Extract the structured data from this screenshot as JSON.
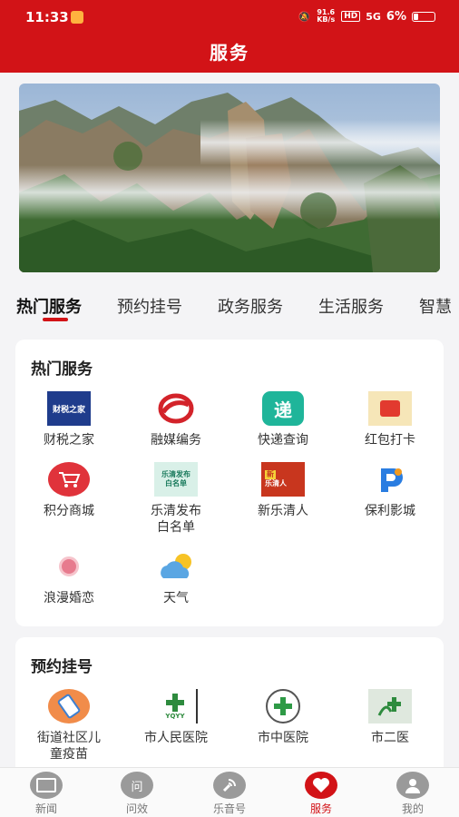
{
  "status_bar": {
    "time": "11:33",
    "net_speed": "91.6 KB/s",
    "hd": "HD",
    "signal": "5G",
    "battery": "6%"
  },
  "header": {
    "title": "服务"
  },
  "tabs": [
    {
      "label": "热门服务",
      "active": true
    },
    {
      "label": "预约挂号",
      "active": false
    },
    {
      "label": "政务服务",
      "active": false
    },
    {
      "label": "生活服务",
      "active": false
    },
    {
      "label": "智慧",
      "active": false
    }
  ],
  "hot_services": {
    "title": "热门服务",
    "items": [
      {
        "label": "财税之家",
        "icon": "tax-home-icon"
      },
      {
        "label": "融媒编务",
        "icon": "media-icon"
      },
      {
        "label": "快递查询",
        "icon": "express-icon"
      },
      {
        "label": "红包打卡",
        "icon": "red-envelope-icon"
      },
      {
        "label": "积分商城",
        "icon": "cart-icon"
      },
      {
        "label": "乐清发布白名单",
        "icon": "whitelist-icon"
      },
      {
        "label": "新乐清人",
        "icon": "new-resident-icon"
      },
      {
        "label": "保利影城",
        "icon": "cinema-icon"
      },
      {
        "label": "浪漫婚恋",
        "icon": "romance-icon"
      },
      {
        "label": "天气",
        "icon": "weather-icon"
      }
    ]
  },
  "appointment": {
    "title": "预约挂号",
    "items": [
      {
        "label": "街道社区儿童疫苗",
        "icon": "vaccine-icon"
      },
      {
        "label": "市人民医院",
        "icon": "peoples-hospital-icon"
      },
      {
        "label": "市中医院",
        "icon": "tcm-hospital-icon"
      },
      {
        "label": "市二医",
        "icon": "second-hospital-icon"
      }
    ]
  },
  "bottom_nav": [
    {
      "label": "新闻",
      "icon": "news-icon",
      "active": false
    },
    {
      "label": "问效",
      "icon": "ask-icon",
      "active": false
    },
    {
      "label": "乐音号",
      "icon": "audio-icon",
      "active": false
    },
    {
      "label": "服务",
      "icon": "service-heart-icon",
      "active": true
    },
    {
      "label": "我的",
      "icon": "profile-icon",
      "active": false
    }
  ],
  "icon_text": {
    "tax_logo": "财税之家",
    "whitelist_logo_1": "乐清发布",
    "whitelist_logo_2": "白名单",
    "newres_logo_1": "新",
    "newres_logo_2": "乐清人",
    "express_logo": "递",
    "hospital_logo": "YQYY",
    "ask_logo": "问"
  }
}
